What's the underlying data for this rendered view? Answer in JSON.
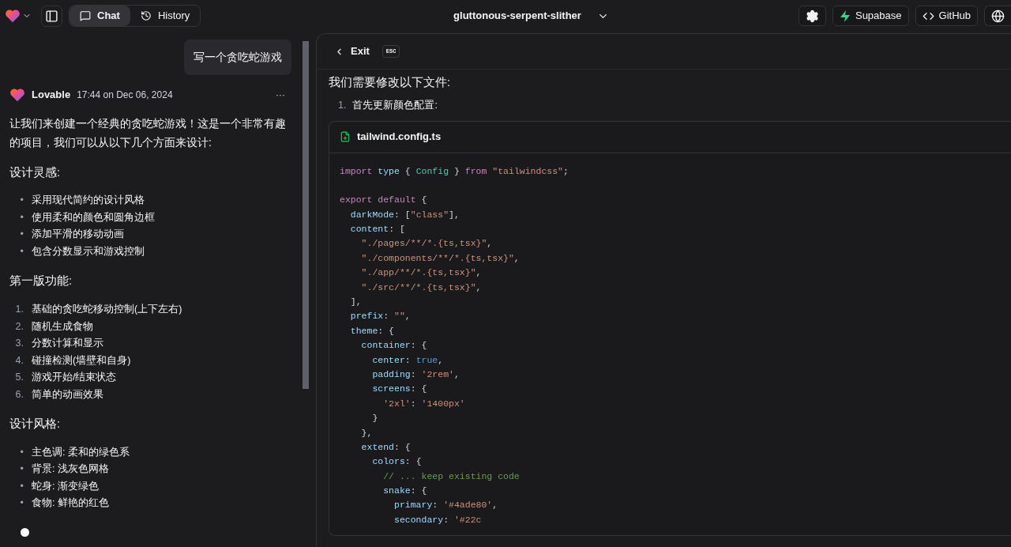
{
  "top_bar": {
    "tabs": [
      {
        "label": "Chat",
        "selected": true
      },
      {
        "label": "History",
        "selected": false
      }
    ],
    "project_title": "gluttonous-serpent-slither",
    "actions": [
      {
        "kind": "settings"
      },
      {
        "kind": "supabase",
        "label": "Supabase"
      },
      {
        "kind": "github",
        "label": "GitHub"
      },
      {
        "kind": "globe"
      }
    ]
  },
  "chat": {
    "user_message": "写一个贪吃蛇游戏",
    "reply": {
      "author": "Lovable",
      "time": "17:44 on Dec 06, 2024",
      "more": "···",
      "intro": "让我们来创建一个经典的贪吃蛇游戏！这是一个非常有趣的项目，我们可以从以下几个方面来设计:",
      "sections": [
        {
          "heading": "设计灵感:",
          "items": [
            {
              "marker": "•",
              "text": "采用现代简约的设计风格"
            },
            {
              "marker": "•",
              "text": "使用柔和的颜色和圆角边框"
            },
            {
              "marker": "•",
              "text": "添加平滑的移动动画"
            },
            {
              "marker": "•",
              "text": "包含分数显示和游戏控制"
            }
          ]
        },
        {
          "heading": "第一版功能:",
          "items": [
            {
              "marker": "1.",
              "text": "基础的贪吃蛇移动控制(上下左右)"
            },
            {
              "marker": "2.",
              "text": "随机生成食物"
            },
            {
              "marker": "3.",
              "text": "分数计算和显示"
            },
            {
              "marker": "4.",
              "text": "碰撞检测(墙壁和自身)"
            },
            {
              "marker": "5.",
              "text": "游戏开始/结束状态"
            },
            {
              "marker": "6.",
              "text": "简单的动画效果"
            }
          ]
        },
        {
          "heading": "设计风格:",
          "items": [
            {
              "marker": "•",
              "text": "主色调: 柔和的绿色系"
            },
            {
              "marker": "•",
              "text": "背景: 浅灰色网格"
            },
            {
              "marker": "•",
              "text": "蛇身: 渐变绿色"
            },
            {
              "marker": "•",
              "text": "食物: 鲜艳的红色"
            }
          ]
        }
      ]
    }
  },
  "code_view": {
    "exit": "Exit",
    "esc": "ESC",
    "heading": "我们需要修改以下文件:",
    "step_number": "1.",
    "step": "首先更新颜色配置:",
    "file": {
      "name": "tailwind.config.ts",
      "blocks": [
        [
          [
            {
              "kind": "keyword",
              "text": "import "
            },
            {
              "kind": "property",
              "text": "type"
            },
            {
              "kind": "plain",
              "text": " { "
            },
            {
              "kind": "type",
              "text": "Config"
            },
            {
              "kind": "plain",
              "text": " } "
            },
            {
              "kind": "keyword",
              "text": "from "
            },
            {
              "kind": "string",
              "text": "\"tailwindcss\""
            },
            {
              "kind": "plain",
              "text": ";"
            }
          ]
        ],
        [
          [
            {
              "kind": "keyword",
              "text": "export default"
            },
            {
              "kind": "plain",
              "text": " {"
            }
          ],
          [
            {
              "kind": "property",
              "text": "  darkMode"
            },
            {
              "kind": "plain",
              "text": ": ["
            },
            {
              "kind": "string",
              "text": "\"class\""
            },
            {
              "kind": "plain",
              "text": "],"
            }
          ],
          [
            {
              "kind": "property",
              "text": "  content"
            },
            {
              "kind": "plain",
              "text": ": ["
            }
          ],
          [
            {
              "kind": "string",
              "text": "    \"./pages/**/*.{ts,tsx}\""
            },
            {
              "kind": "plain",
              "text": ","
            }
          ],
          [
            {
              "kind": "string",
              "text": "    \"./components/**/*.{ts,tsx}\""
            },
            {
              "kind": "plain",
              "text": ","
            }
          ],
          [
            {
              "kind": "string",
              "text": "    \"./app/**/*.{ts,tsx}\""
            },
            {
              "kind": "plain",
              "text": ","
            }
          ],
          [
            {
              "kind": "string",
              "text": "    \"./src/**/*.{ts,tsx}\""
            },
            {
              "kind": "plain",
              "text": ","
            }
          ],
          [
            {
              "kind": "plain",
              "text": "  ],"
            }
          ],
          [
            {
              "kind": "property",
              "text": "  prefix"
            },
            {
              "kind": "plain",
              "text": ": "
            },
            {
              "kind": "string",
              "text": "\"\""
            },
            {
              "kind": "plain",
              "text": ","
            }
          ],
          [
            {
              "kind": "property",
              "text": "  theme"
            },
            {
              "kind": "plain",
              "text": ": {"
            }
          ],
          [
            {
              "kind": "property",
              "text": "    container"
            },
            {
              "kind": "plain",
              "text": ": {"
            }
          ],
          [
            {
              "kind": "property",
              "text": "      center"
            },
            {
              "kind": "plain",
              "text": ": "
            },
            {
              "kind": "boolean",
              "text": "true"
            },
            {
              "kind": "plain",
              "text": ","
            }
          ],
          [
            {
              "kind": "property",
              "text": "      padding"
            },
            {
              "kind": "plain",
              "text": ": "
            },
            {
              "kind": "string",
              "text": "'2rem'"
            },
            {
              "kind": "plain",
              "text": ","
            }
          ],
          [
            {
              "kind": "property",
              "text": "      screens"
            },
            {
              "kind": "plain",
              "text": ": {"
            }
          ],
          [
            {
              "kind": "string",
              "text": "        '2xl'"
            },
            {
              "kind": "plain",
              "text": ": "
            },
            {
              "kind": "string",
              "text": "'1400px'"
            }
          ],
          [
            {
              "kind": "plain",
              "text": "      }"
            }
          ],
          [
            {
              "kind": "plain",
              "text": "    },"
            }
          ],
          [
            {
              "kind": "property",
              "text": "    extend"
            },
            {
              "kind": "plain",
              "text": ": {"
            }
          ],
          [
            {
              "kind": "property",
              "text": "      colors"
            },
            {
              "kind": "plain",
              "text": ": {"
            }
          ],
          [
            {
              "kind": "comment",
              "text": "        // ... keep existing code"
            }
          ],
          [
            {
              "kind": "property",
              "text": "        snake"
            },
            {
              "kind": "plain",
              "text": ": {"
            }
          ],
          [
            {
              "kind": "property",
              "text": "          primary"
            },
            {
              "kind": "plain",
              "text": ": "
            },
            {
              "kind": "string",
              "text": "'#4ade80'"
            },
            {
              "kind": "plain",
              "text": ","
            }
          ],
          [
            {
              "kind": "property",
              "text": "          secondary"
            },
            {
              "kind": "plain",
              "text": ": "
            },
            {
              "kind": "string",
              "text": "'#22c"
            }
          ]
        ]
      ]
    }
  }
}
